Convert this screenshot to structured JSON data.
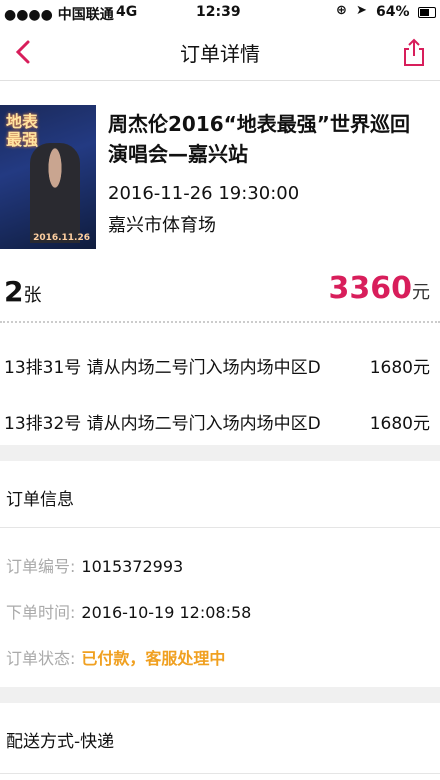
{
  "status_bar": {
    "carrier": "●●●● 中国联通",
    "network": "4G",
    "time": "12:39",
    "battery": "64%"
  },
  "nav": {
    "title": "订单详情",
    "accent_color": "#d81e5b"
  },
  "event": {
    "title": "周杰伦2016“地表最强”世界巡回演唱会—嘉兴站",
    "datetime": "2016-11-26 19:30:00",
    "venue": "嘉兴市体育场",
    "poster": {
      "title_line1": "地表",
      "title_line2": "最强",
      "date": "2016.11.26"
    }
  },
  "summary": {
    "quantity": "2",
    "quantity_unit": "张",
    "total": "3360",
    "total_unit": "元"
  },
  "tickets": [
    {
      "seat": "13排31号",
      "location": "请从内场二号门入场内场中区D",
      "price": "1680元"
    },
    {
      "seat": "13排32号",
      "location": "请从内场二号门入场内场中区D",
      "price": "1680元"
    }
  ],
  "order_info": {
    "title": "订单信息",
    "number_label": "订单编号:",
    "number_value": "1015372993",
    "time_label": "下单时间:",
    "time_value": "2016-10-19 12:08:58",
    "status_label": "订单状态:",
    "status_value": "已付款，客服处理中"
  },
  "delivery": {
    "title": "配送方式-快递"
  }
}
